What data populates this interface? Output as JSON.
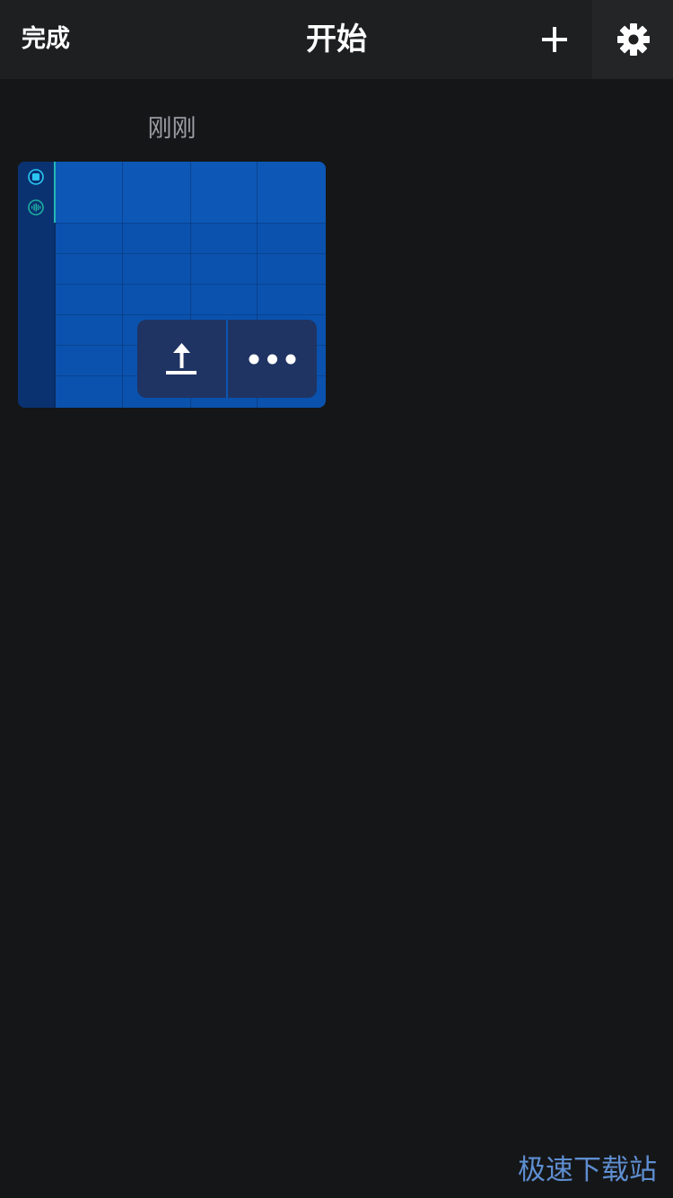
{
  "navbar": {
    "done_label": "完成",
    "title": "开始",
    "add_icon": "plus-icon",
    "settings_icon": "gear-icon"
  },
  "projects": {
    "section_label": "刚刚",
    "card": {
      "track_icons": [
        "record-track-icon",
        "audio-track-icon"
      ],
      "actions": {
        "share_icon": "share-upload-icon",
        "more_icon": "more-dots-icon"
      }
    }
  },
  "watermark": "极速下载站",
  "colors": {
    "background": "#151618",
    "navbar": "#1e1f21",
    "card": "#0a52ad",
    "card_actions": "#1f3463",
    "accent_teal": "#24b7b4",
    "accent_cyan": "#2bc6f0"
  }
}
